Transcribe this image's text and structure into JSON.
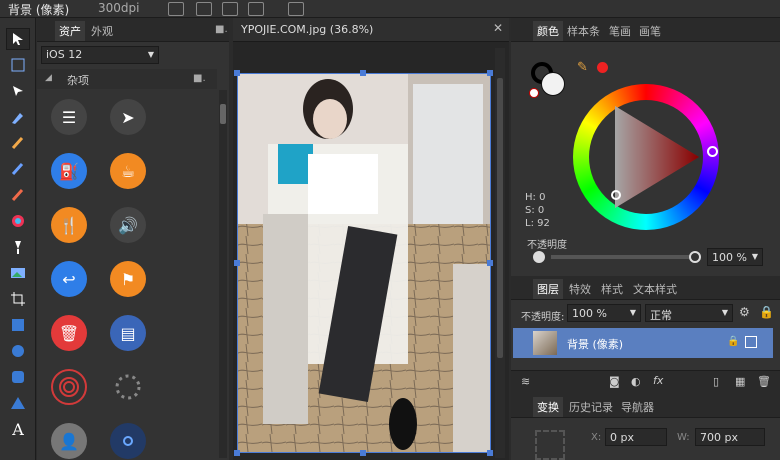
{
  "topbar": {
    "title": "背景 (像素)",
    "dpi": "300dpi"
  },
  "assets": {
    "tabs": [
      "资产",
      "外观"
    ],
    "ios_select": "iOS 12",
    "section_title": "杂项"
  },
  "document": {
    "tab_title": "YPOJIE.COM.jpg (36.8%)"
  },
  "color": {
    "tabs": [
      "颜色",
      "样本条",
      "笔画",
      "画笔"
    ],
    "h": "H: 0",
    "s": "S: 0",
    "l": "L: 92",
    "opacity_label": "不透明度",
    "opacity_value": "100 %"
  },
  "layers": {
    "tabs": [
      "图层",
      "特效",
      "样式",
      "文本样式"
    ],
    "opacity_label": "不透明度:",
    "opacity_value": "100 %",
    "blend_mode": "正常",
    "layer_name": "背景 (像素)"
  },
  "transform": {
    "tabs": [
      "变换",
      "历史记录",
      "导航器"
    ],
    "x_label": "X:",
    "x_value": "0 px",
    "w_label": "W:",
    "w_value": "700 px"
  }
}
